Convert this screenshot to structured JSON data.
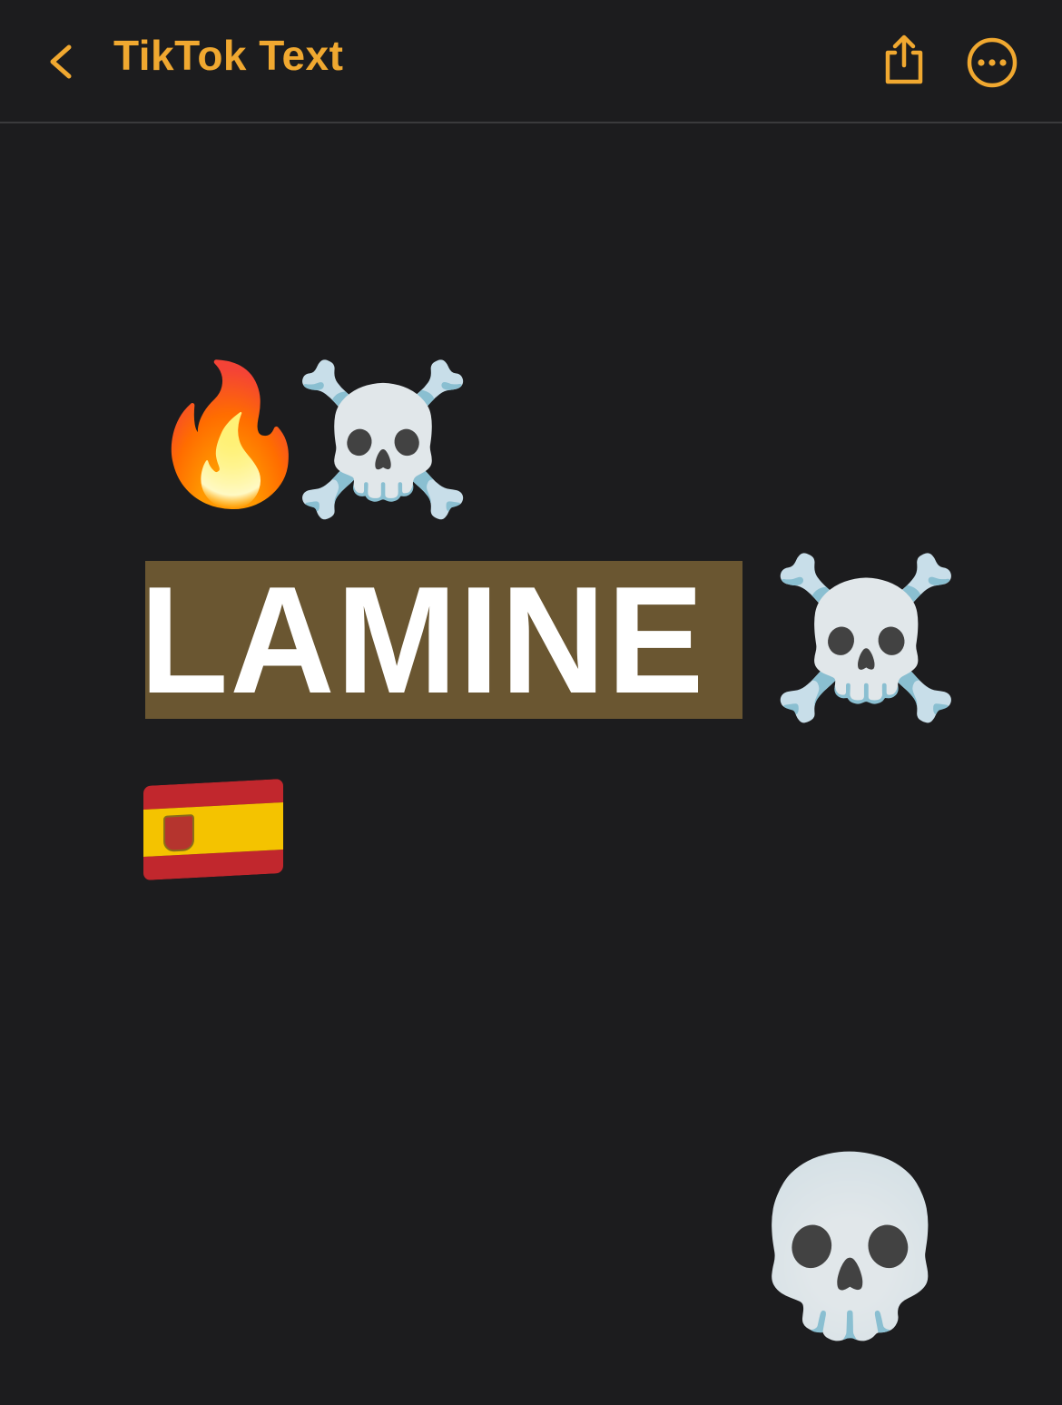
{
  "header": {
    "title": "TikTok Text",
    "back_icon": "chevron-left-icon",
    "share_icon": "share-icon",
    "more_icon": "ellipsis-circle-icon",
    "accent_color": "#f0a830"
  },
  "note": {
    "line1": {
      "emoji_fire": "🔥",
      "emoji_skull_crossbones": "☠️"
    },
    "line2": {
      "text": "LAMINE",
      "highlight_color": "#6a5631",
      "emoji_skull_crossbones": "☠️"
    },
    "line3": {
      "emoji_flag": "spain-flag"
    },
    "line4": {
      "emoji_skull": "💀"
    }
  }
}
